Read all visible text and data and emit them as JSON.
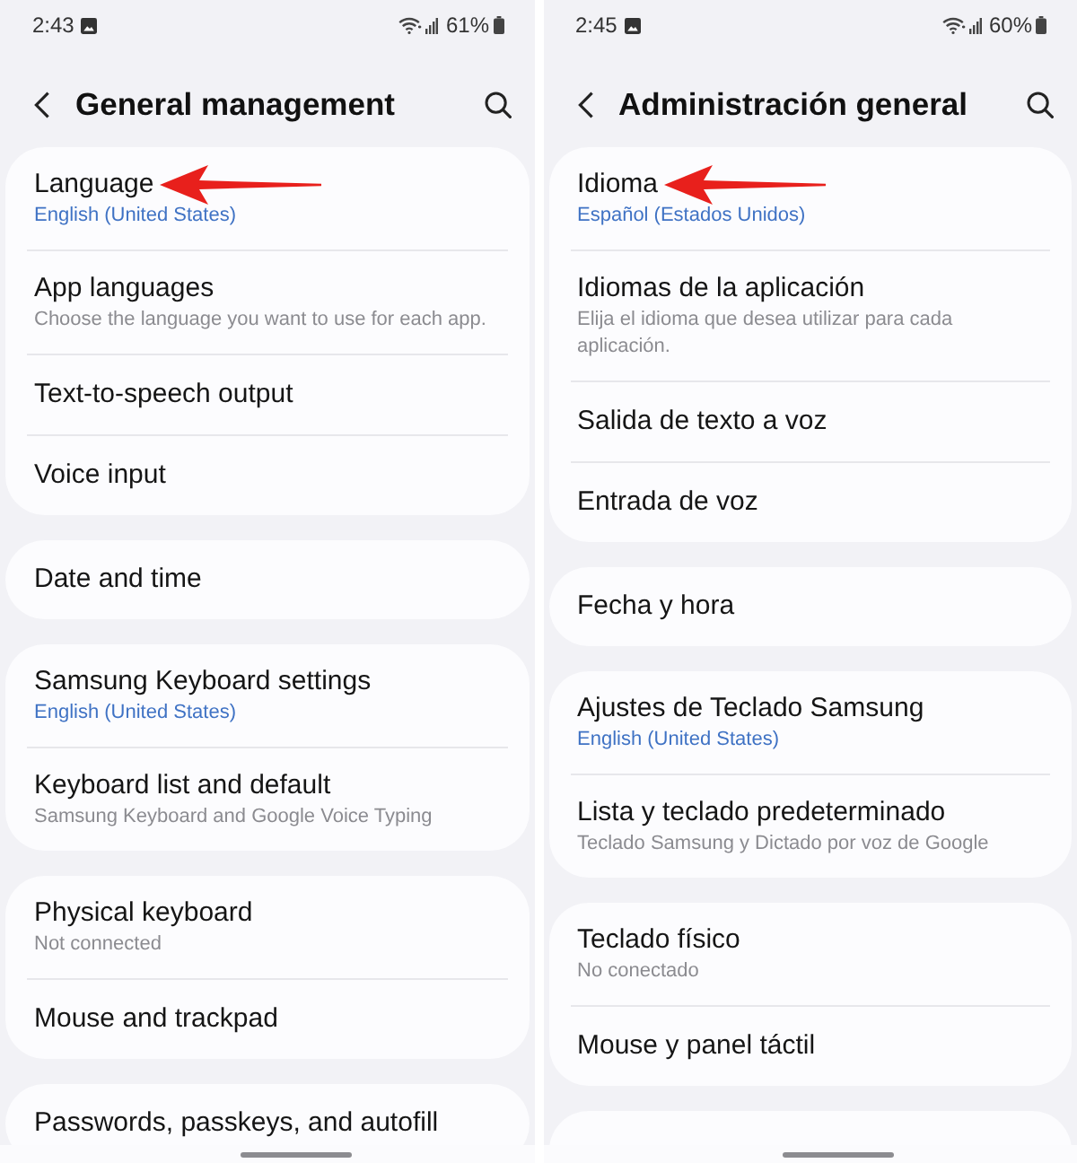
{
  "screens": [
    {
      "status_bar": {
        "time": "2:43",
        "battery": "61%"
      },
      "header": {
        "title": "General management"
      },
      "groups": [
        {
          "kind": "list",
          "items": [
            {
              "kind": "value",
              "title": "Language",
              "subtitle": "English (United States)",
              "pointer_arrow": true
            },
            {
              "kind": "description",
              "title": "App languages",
              "subtitle": "Choose the language you want to use for each app.",
              "pointer_arrow": false
            },
            {
              "kind": "plain",
              "title": "Text-to-speech output",
              "pointer_arrow": false
            },
            {
              "kind": "plain",
              "title": "Voice input",
              "pointer_arrow": false
            }
          ]
        },
        {
          "kind": "list",
          "items": [
            {
              "kind": "plain",
              "title": "Date and time",
              "pointer_arrow": false
            }
          ]
        },
        {
          "kind": "list",
          "items": [
            {
              "kind": "value",
              "title": "Samsung Keyboard settings",
              "subtitle": "English (United States)",
              "pointer_arrow": false
            },
            {
              "kind": "description",
              "title": "Keyboard list and default",
              "subtitle": "Samsung Keyboard and Google Voice Typing",
              "pointer_arrow": false
            }
          ]
        },
        {
          "kind": "list",
          "items": [
            {
              "kind": "description",
              "title": "Physical keyboard",
              "subtitle": "Not connected",
              "pointer_arrow": false
            },
            {
              "kind": "plain",
              "title": "Mouse and trackpad",
              "pointer_arrow": false
            }
          ]
        },
        {
          "kind": "list",
          "items": [
            {
              "kind": "plain",
              "title": "Passwords, passkeys, and autofill",
              "pointer_arrow": false
            }
          ]
        }
      ]
    },
    {
      "status_bar": {
        "time": "2:45",
        "battery": "60%"
      },
      "header": {
        "title": "Administración general"
      },
      "groups": [
        {
          "kind": "list",
          "items": [
            {
              "kind": "value",
              "title": "Idioma",
              "subtitle": "Español (Estados Unidos)",
              "pointer_arrow": true
            },
            {
              "kind": "description",
              "title": "Idiomas de la aplicación",
              "subtitle": "Elija el idioma que desea utilizar para cada aplicación.",
              "pointer_arrow": false
            },
            {
              "kind": "plain",
              "title": "Salida de texto a voz",
              "pointer_arrow": false
            },
            {
              "kind": "plain",
              "title": "Entrada de voz",
              "pointer_arrow": false
            }
          ]
        },
        {
          "kind": "list",
          "items": [
            {
              "kind": "plain",
              "title": "Fecha y hora",
              "pointer_arrow": false
            }
          ]
        },
        {
          "kind": "list",
          "items": [
            {
              "kind": "value",
              "title": "Ajustes de Teclado Samsung",
              "subtitle": "English (United States)",
              "pointer_arrow": false
            },
            {
              "kind": "description",
              "title": "Lista y teclado predeterminado",
              "subtitle": "Teclado Samsung y Dictado por voz de Google",
              "pointer_arrow": false
            }
          ]
        },
        {
          "kind": "list",
          "items": [
            {
              "kind": "description",
              "title": "Teclado físico",
              "subtitle": "No conectado",
              "pointer_arrow": false
            },
            {
              "kind": "plain",
              "title": "Mouse y panel táctil",
              "pointer_arrow": false
            }
          ]
        },
        {
          "kind": "empty"
        }
      ]
    }
  ]
}
